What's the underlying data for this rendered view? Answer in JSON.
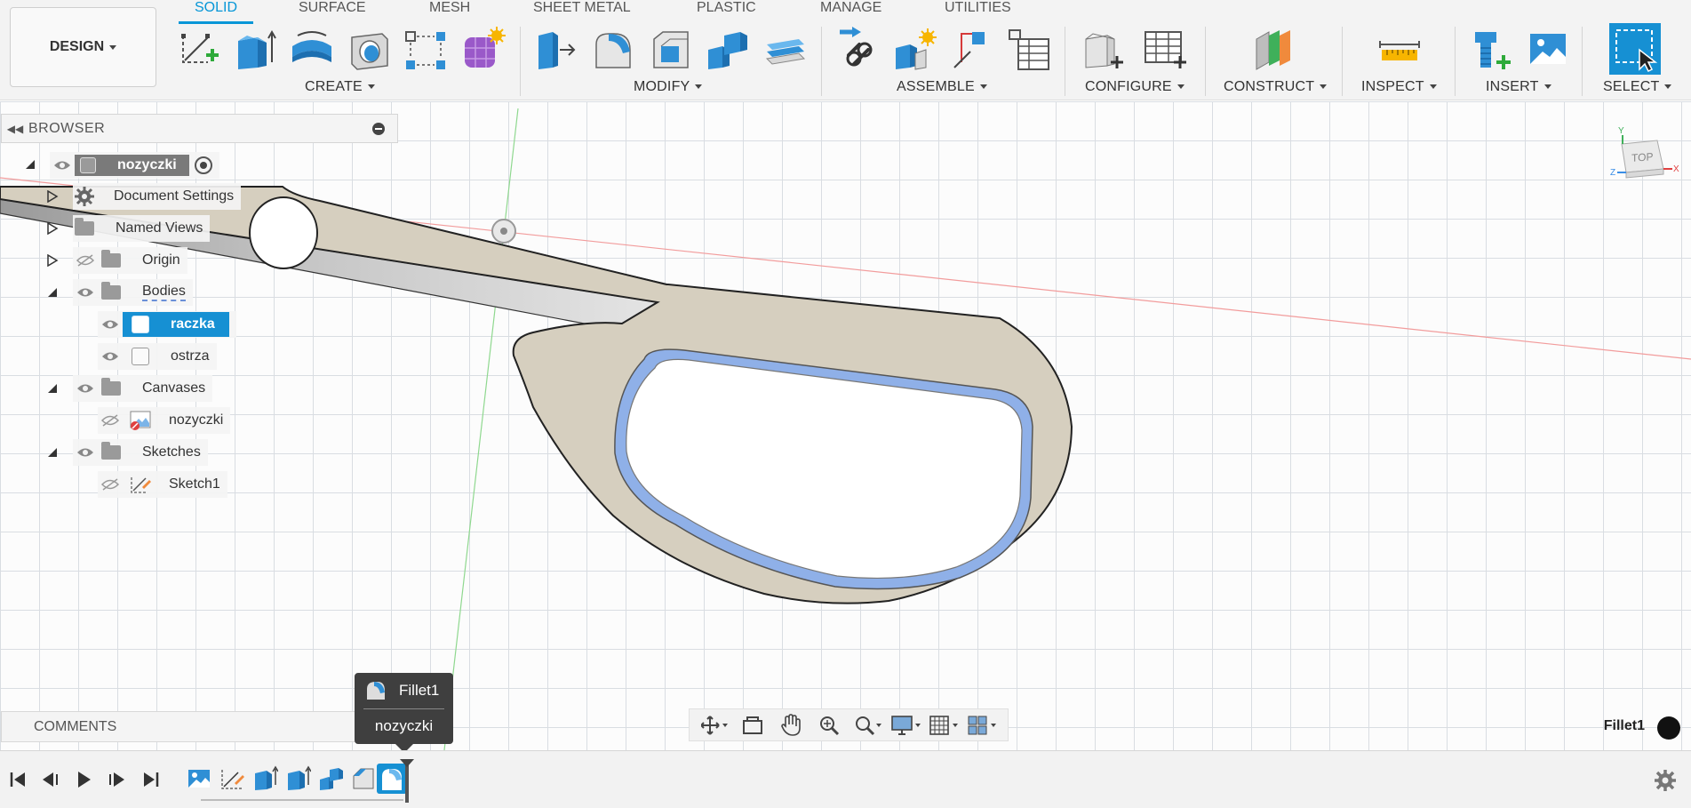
{
  "toolbar": {
    "workspace": "DESIGN",
    "tabs": [
      "SOLID",
      "SURFACE",
      "MESH",
      "SHEET METAL",
      "PLASTIC",
      "MANAGE",
      "UTILITIES"
    ],
    "groups": {
      "create": "CREATE",
      "modify": "MODIFY",
      "assemble": "ASSEMBLE",
      "configure": "CONFIGURE",
      "construct": "CONSTRUCT",
      "inspect": "INSPECT",
      "insert": "INSERT",
      "select": "SELECT"
    }
  },
  "browser": {
    "title": "BROWSER",
    "root": "nozyczki",
    "items": {
      "document_settings": "Document Settings",
      "named_views": "Named Views",
      "origin": "Origin",
      "bodies": "Bodies",
      "body1": "raczka",
      "body2": "ostrza",
      "canvases": "Canvases",
      "canvas1": "nozyczki",
      "sketches": "Sketches",
      "sketch1": "Sketch1"
    }
  },
  "viewcube": {
    "face": "TOP",
    "axis_x": "X",
    "axis_y": "Y",
    "axis_z": "Z"
  },
  "comments": {
    "label": "COMMENTS"
  },
  "tooltip": {
    "feature": "Fillet1",
    "component": "nozyczki"
  },
  "status": {
    "current_feature": "Fillet1"
  },
  "colors": {
    "accent": "#0696d7",
    "selection": "#1690d3",
    "body": "#d6cfbf",
    "fillet_highlight": "#8fb0e8"
  }
}
